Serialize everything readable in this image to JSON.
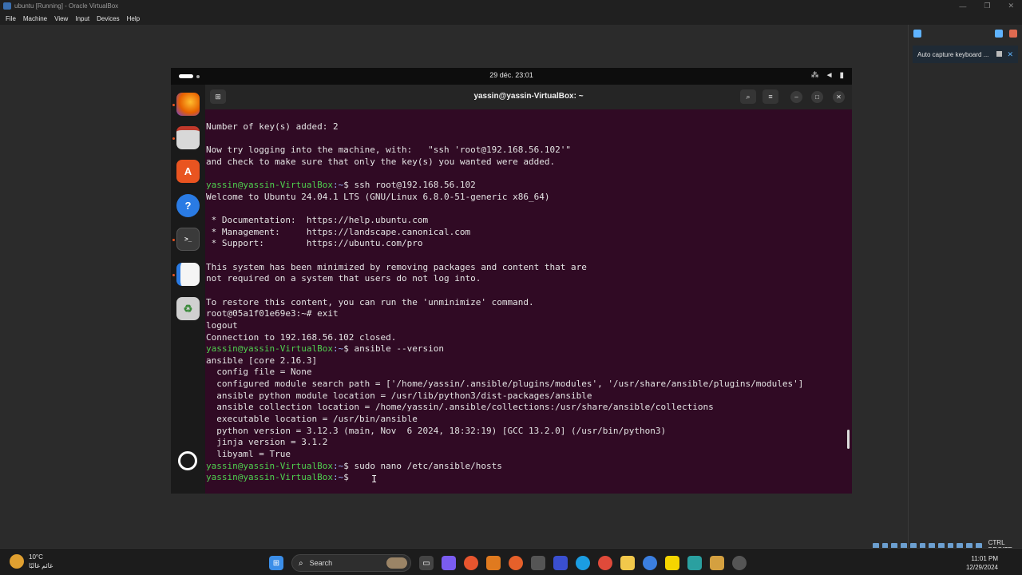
{
  "host": {
    "title": "ubuntu [Running] - Oracle VirtualBox",
    "menu": [
      "File",
      "Machine",
      "View",
      "Input",
      "Devices",
      "Help"
    ],
    "notification": "Auto capture keyboard ...",
    "host_key": "CTRL DROITE"
  },
  "guest": {
    "clock": "29 déc.  23:01",
    "terminal_title": "yassin@yassin-VirtualBox: ~",
    "dock": [
      {
        "name": "firefox-icon"
      },
      {
        "name": "files-icon"
      },
      {
        "name": "app-center-icon",
        "glyph": "A"
      },
      {
        "name": "help-icon",
        "glyph": "?"
      },
      {
        "name": "terminal-icon",
        "glyph": ">_"
      },
      {
        "name": "text-editor-icon"
      },
      {
        "name": "trash-icon",
        "glyph": "♻"
      }
    ],
    "terminal_lines": [
      {
        "text": "Number of key(s) added: 2"
      },
      {
        "text": ""
      },
      {
        "text": "Now try logging into the machine, with:   \"ssh 'root@192.168.56.102'\""
      },
      {
        "text": "and check to make sure that only the key(s) you wanted were added."
      },
      {
        "text": ""
      },
      {
        "prompt": "yassin@yassin-VirtualBox",
        "path": ":~",
        "text": "$ ssh root@192.168.56.102"
      },
      {
        "text": "Welcome to Ubuntu 24.04.1 LTS (GNU/Linux 6.8.0-51-generic x86_64)"
      },
      {
        "text": ""
      },
      {
        "text": " * Documentation:  https://help.ubuntu.com"
      },
      {
        "text": " * Management:     https://landscape.canonical.com"
      },
      {
        "text": " * Support:        https://ubuntu.com/pro"
      },
      {
        "text": ""
      },
      {
        "text": "This system has been minimized by removing packages and content that are"
      },
      {
        "text": "not required on a system that users do not log into."
      },
      {
        "text": ""
      },
      {
        "text": "To restore this content, you can run the 'unminimize' command."
      },
      {
        "text": "root@05a1f01e69e3:~# exit"
      },
      {
        "text": "logout"
      },
      {
        "text": "Connection to 192.168.56.102 closed."
      },
      {
        "prompt": "yassin@yassin-VirtualBox",
        "path": ":~",
        "text": "$ ansible --version"
      },
      {
        "text": "ansible [core 2.16.3]"
      },
      {
        "text": "  config file = None"
      },
      {
        "text": "  configured module search path = ['/home/yassin/.ansible/plugins/modules', '/usr/share/ansible/plugins/modules']"
      },
      {
        "text": "  ansible python module location = /usr/lib/python3/dist-packages/ansible"
      },
      {
        "text": "  ansible collection location = /home/yassin/.ansible/collections:/usr/share/ansible/collections"
      },
      {
        "text": "  executable location = /usr/bin/ansible"
      },
      {
        "text": "  python version = 3.12.3 (main, Nov  6 2024, 18:32:19) [GCC 13.2.0] (/usr/bin/python3)"
      },
      {
        "text": "  jinja version = 3.1.2"
      },
      {
        "text": "  libyaml = True"
      },
      {
        "prompt": "yassin@yassin-VirtualBox",
        "path": ":~",
        "text": "$ sudo nano /etc/ansible/hosts"
      },
      {
        "prompt": "yassin@yassin-VirtualBox",
        "path": ":~",
        "text": "$ "
      }
    ]
  },
  "taskbar": {
    "weather_temp": "10°C",
    "weather_desc": "غائم غالبًا",
    "search_placeholder": "Search",
    "time": "11:01 PM",
    "date": "12/29/2024"
  }
}
